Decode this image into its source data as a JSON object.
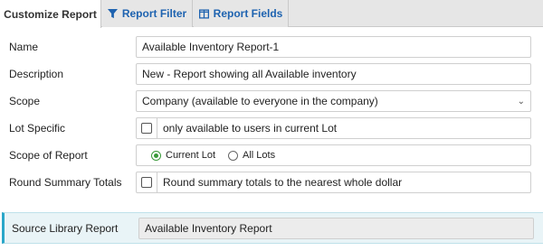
{
  "tabs": [
    {
      "label": "Customize Report",
      "active": true
    },
    {
      "label": "Report Filter",
      "icon": "filter-icon"
    },
    {
      "label": "Report Fields",
      "icon": "columns-icon"
    }
  ],
  "form": {
    "name": {
      "label": "Name",
      "value": "Available Inventory Report-1"
    },
    "description": {
      "label": "Description",
      "value": "New - Report showing all Available inventory"
    },
    "scope": {
      "label": "Scope",
      "value": "Company (available to everyone in the company)"
    },
    "lot_specific": {
      "label": "Lot Specific",
      "checked": false,
      "text": "only available to users in current Lot"
    },
    "scope_of_report": {
      "label": "Scope of Report",
      "options": [
        "Current Lot",
        "All Lots"
      ],
      "selected": "Current Lot"
    },
    "round_summary": {
      "label": "Round Summary Totals",
      "checked": false,
      "text": "Round summary totals to the nearest whole dollar"
    }
  },
  "source_library": {
    "label": "Source Library Report",
    "value": "Available Inventory Report"
  },
  "colors": {
    "accent": "#1e63b0",
    "radio_on": "#3a9a3a",
    "source_border": "#2aa7c9"
  }
}
